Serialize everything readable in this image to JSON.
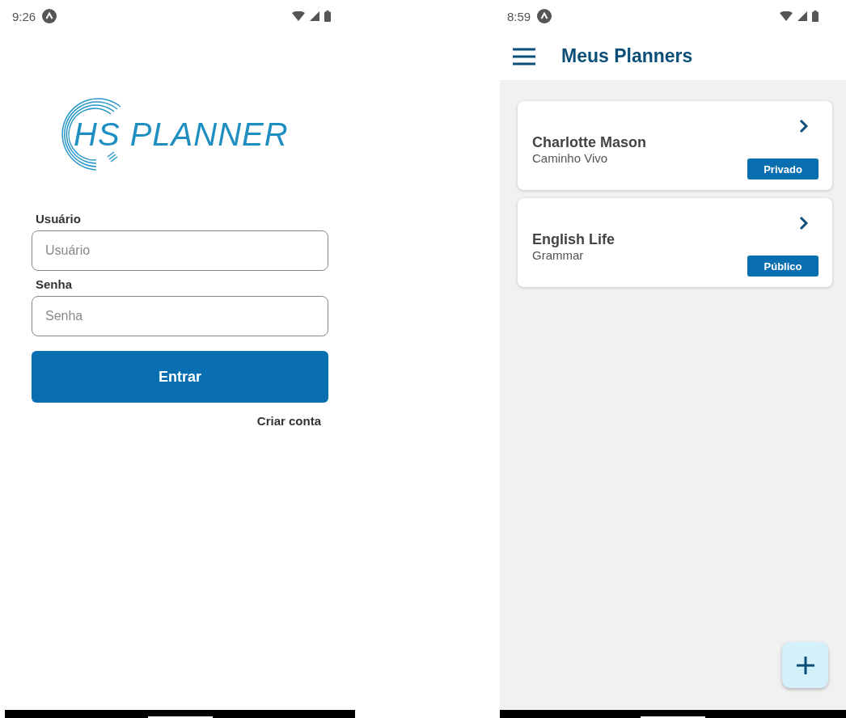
{
  "login_screen": {
    "status_bar": {
      "time": "9:26"
    },
    "logo": {
      "text": "HS PLANNER"
    },
    "fields": [
      {
        "label": "Usuário",
        "placeholder": "Usuário"
      },
      {
        "label": "Senha",
        "placeholder": "Senha"
      }
    ],
    "login_button": "Entrar",
    "create_account_link": "Criar conta"
  },
  "planners_screen": {
    "status_bar": {
      "time": "8:59"
    },
    "header": {
      "title": "Meus Planners"
    },
    "planners": [
      {
        "title": "Charlotte Mason",
        "subtitle": "Caminho Vivo",
        "visibility": "Privado"
      },
      {
        "title": "English Life",
        "subtitle": "Grammar",
        "visibility": "Público"
      }
    ]
  }
}
